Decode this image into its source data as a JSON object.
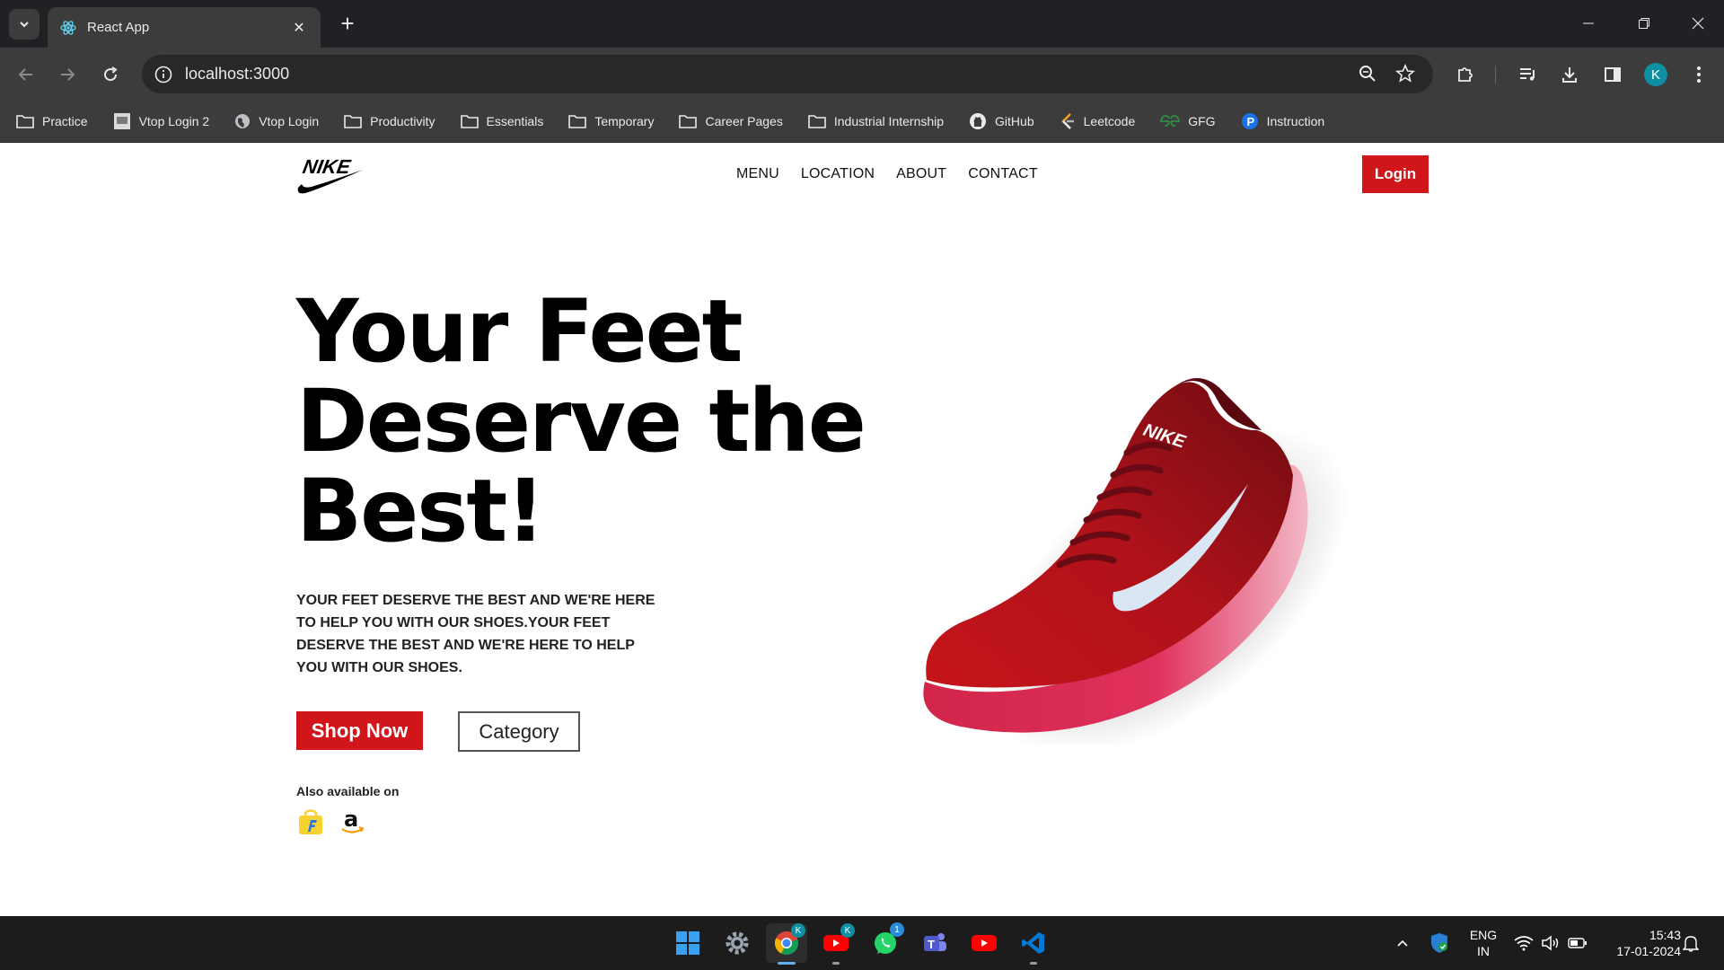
{
  "browser": {
    "tab_title": "React App",
    "url": "localhost:3000",
    "avatar_letter": "K",
    "bookmarks": [
      {
        "label": "Practice",
        "icon": "folder-icon"
      },
      {
        "label": "Vtop Login 2",
        "icon": "site-favicon"
      },
      {
        "label": "Vtop Login",
        "icon": "globe-icon"
      },
      {
        "label": "Productivity",
        "icon": "folder-icon"
      },
      {
        "label": "Essentials",
        "icon": "folder-icon"
      },
      {
        "label": "Temporary",
        "icon": "folder-icon"
      },
      {
        "label": "Career Pages",
        "icon": "folder-icon"
      },
      {
        "label": "Industrial Internship",
        "icon": "folder-icon"
      },
      {
        "label": "GitHub",
        "icon": "github-icon"
      },
      {
        "label": "Leetcode",
        "icon": "leetcode-icon"
      },
      {
        "label": "GFG",
        "icon": "gfg-icon"
      },
      {
        "label": "Instruction",
        "icon": "p-icon"
      }
    ]
  },
  "site": {
    "logo_text": "NIKE",
    "nav": [
      "MENU",
      "LOCATION",
      "ABOUT",
      "CONTACT"
    ],
    "login_label": "Login",
    "hero_title_lines": [
      "Your Feet",
      "Deserve the",
      "Best!"
    ],
    "hero_text": "YOUR FEET DESERVE THE BEST AND WE'RE HERE TO HELP YOU WITH OUR SHOES.YOUR FEET DESERVE THE BEST AND WE'RE HERE TO HELP YOU WITH OUR SHOES.",
    "shop_now_label": "Shop Now",
    "category_label": "Category",
    "also_available": "Also available on",
    "accent_color": "#d0151b"
  },
  "taskbar": {
    "lang_line1": "ENG",
    "lang_line2": "IN",
    "time": "15:43",
    "date": "17-01-2024",
    "whatsapp_badge": "1",
    "profile_badge": "K"
  }
}
